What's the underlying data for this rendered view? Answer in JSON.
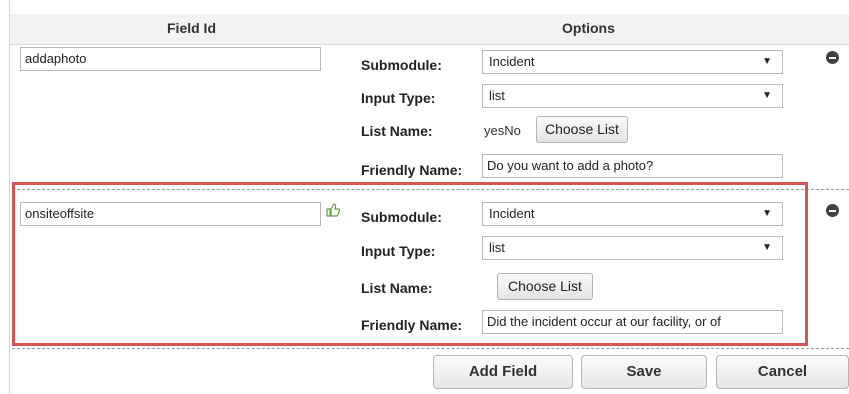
{
  "header": {
    "field_id": "Field Id",
    "options": "Options"
  },
  "rows": [
    {
      "field_id": "addaphoto",
      "submodule_label": "Submodule:",
      "submodule_value": "Incident",
      "input_type_label": "Input Type:",
      "input_type_value": "list",
      "list_name_label": "List Name:",
      "list_name_value": "yesNo",
      "choose_list": "Choose List",
      "friendly_name_label": "Friendly Name:",
      "friendly_name_value": "Do you want to add a photo?"
    },
    {
      "field_id": "onsiteoffsite",
      "submodule_label": "Submodule:",
      "submodule_value": "Incident",
      "input_type_label": "Input Type:",
      "input_type_value": "list",
      "list_name_label": "List Name:",
      "list_name_value": "",
      "choose_list": "Choose List",
      "friendly_name_label": "Friendly Name:",
      "friendly_name_value": "Did the incident occur at our facility, or of"
    }
  ],
  "icons": {
    "dropdown": "▼",
    "thumbs_up": "thumbs-up-icon",
    "remove": "minus-circle-icon"
  },
  "colors": {
    "highlight": "#d9534f",
    "thumbs_up": "#5aa53a"
  },
  "actions": {
    "add_field": "Add Field",
    "save": "Save",
    "cancel": "Cancel"
  }
}
